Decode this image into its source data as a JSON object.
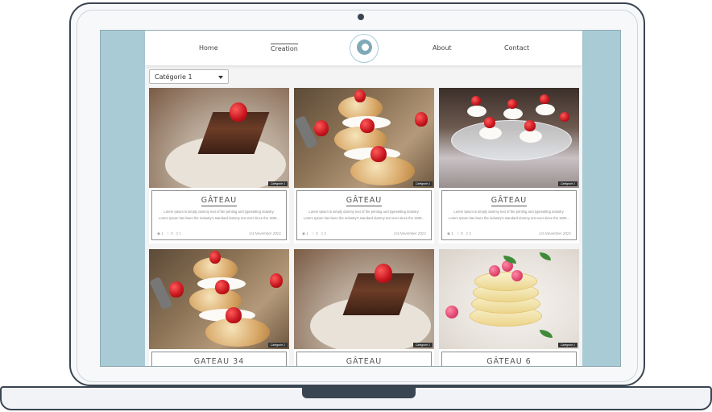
{
  "nav": {
    "home": "Home",
    "creation": "Creation",
    "about": "About",
    "contact": "Contact"
  },
  "filter": {
    "selected": "Catégorie 1"
  },
  "cards": [
    {
      "title": "GÂTEAU",
      "category": "Catégorie 1",
      "description": "Lorem Ipsum is simply dummy text of the printing and typesetting industry. Lorem Ipsum has been the industry's standard dummy text ever since the 1500...",
      "views": "1",
      "likes": "3",
      "comments": "1",
      "date": "1st November 2021",
      "image": "chocolate-cake-slice"
    },
    {
      "title": "GÂTEAU",
      "category": "Catégorie 1",
      "description": "Lorem Ipsum is simply dummy text of the printing and typesetting industry. Lorem Ipsum has been the industry's standard dummy text ever since the 1500...",
      "views": "1",
      "likes": "3",
      "comments": "2",
      "date": "1st November 2021",
      "image": "strawberry-cream-puffs"
    },
    {
      "title": "GÂTEAU",
      "category": "Catégorie 1",
      "description": "Lorem Ipsum is simply dummy text of the printing and typesetting industry. Lorem Ipsum has been the industry's standard dummy text ever since the 1500...",
      "views": "1",
      "likes": "3",
      "comments": "2",
      "date": "1st November 2021",
      "image": "mini-strawberry-tarts"
    },
    {
      "title": "GATEAU 34",
      "category": "Catégorie 1",
      "image": "strawberry-cream-puffs"
    },
    {
      "title": "GÂTEAU",
      "category": "Catégorie 1",
      "image": "chocolate-cake-slice"
    },
    {
      "title": "GÂTEAU 6",
      "category": "Catégorie 1",
      "image": "raspberry-pancakes"
    }
  ],
  "icons": {
    "views": "eye-icon",
    "likes": "heart-icon",
    "comments": "comment-icon",
    "dropdown": "chevron-down-icon"
  },
  "colors": {
    "screen_background": "#a9cbd6",
    "page_background": "#f4f4f4",
    "frame": "#3a4552"
  }
}
